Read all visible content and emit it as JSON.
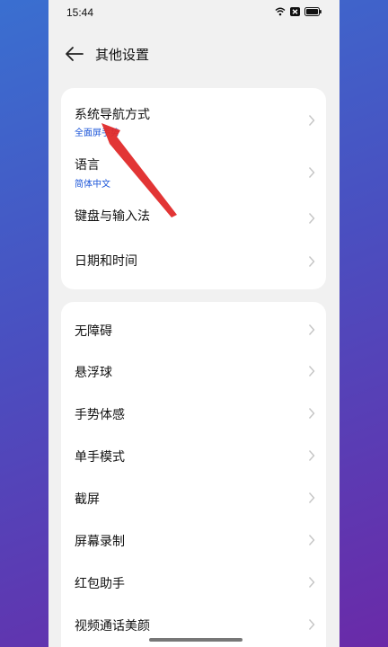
{
  "status": {
    "time": "15:44"
  },
  "header": {
    "title": "其他设置"
  },
  "group1": [
    {
      "label": "系统导航方式",
      "sub": "全面屏手势"
    },
    {
      "label": "语言",
      "sub": "简体中文"
    },
    {
      "label": "键盘与输入法"
    },
    {
      "label": "日期和时间"
    }
  ],
  "group2": [
    {
      "label": "无障碍"
    },
    {
      "label": "悬浮球"
    },
    {
      "label": "手势体感"
    },
    {
      "label": "单手模式"
    },
    {
      "label": "截屏"
    },
    {
      "label": "屏幕录制"
    },
    {
      "label": "红包助手"
    },
    {
      "label": "视频通话美颜"
    }
  ],
  "colors": {
    "accent": "#1a54d8",
    "annotation": "#e02a2a"
  }
}
